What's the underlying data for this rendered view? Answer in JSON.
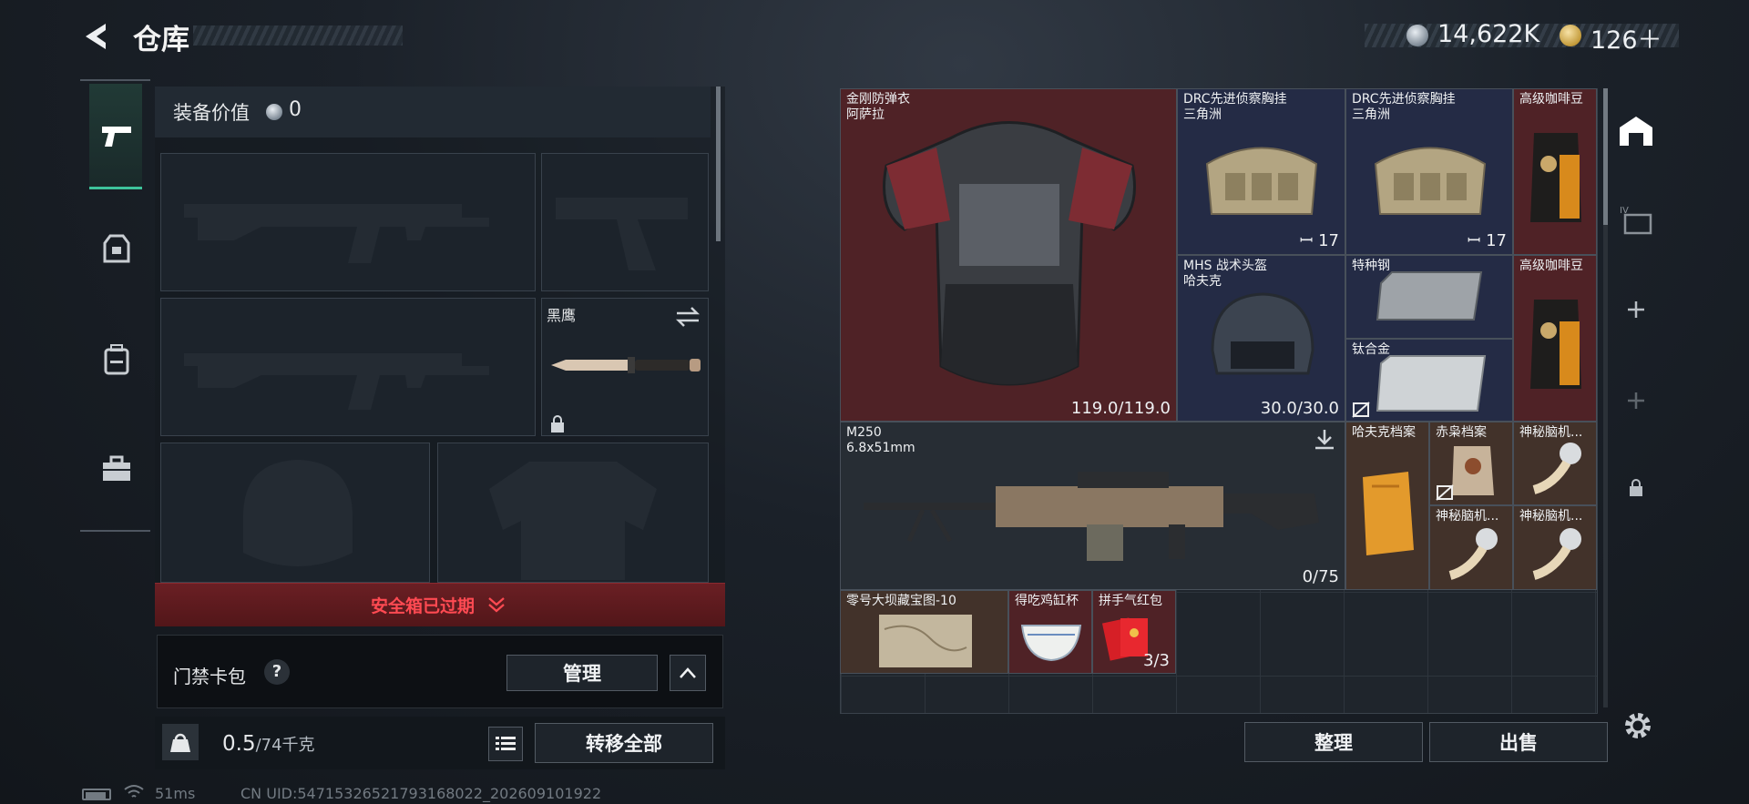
{
  "header": {
    "title": "仓库",
    "currency_silver": "14,622K",
    "currency_gold": "126＋"
  },
  "left_nav": [
    {
      "name": "weapon",
      "icon": "pistol-icon",
      "active": true
    },
    {
      "name": "armor",
      "icon": "vest-icon"
    },
    {
      "name": "backpack",
      "icon": "backpack-icon"
    },
    {
      "name": "kit",
      "icon": "toolbox-icon"
    }
  ],
  "loadout": {
    "value_label": "装备价值",
    "value": "0",
    "melee_name": "黑鹰",
    "safebox_status": "安全箱已过期",
    "card_pack_label": "门禁卡包",
    "card_help": "?",
    "manage_label": "管理",
    "weight_value": "0.5",
    "weight_capacity": "/74千克",
    "transfer_all_label": "转移全部"
  },
  "inventory": {
    "items": [
      {
        "id": "armor",
        "name": "金刚防弹衣\n阿萨拉",
        "count": "119.0/119.0",
        "rarity": "red"
      },
      {
        "id": "vest1",
        "name": "DRC先进侦察胸挂\n三角洲",
        "count": "17",
        "rarity": "blue"
      },
      {
        "id": "vest2",
        "name": "DRC先进侦察胸挂\n三角洲",
        "count": "17",
        "rarity": "blue"
      },
      {
        "id": "coffee1",
        "name": "高级咖啡豆",
        "count": "",
        "rarity": "red"
      },
      {
        "id": "helmet",
        "name": "MHS 战术头盔\n哈夫克",
        "count": "30.0/30.0",
        "rarity": "blue"
      },
      {
        "id": "steel",
        "name": "特种钢",
        "count": "",
        "rarity": "blue"
      },
      {
        "id": "alloy",
        "name": "钛合金",
        "count": "",
        "rarity": "blue"
      },
      {
        "id": "coffee2",
        "name": "高级咖啡豆",
        "count": "",
        "rarity": "red"
      },
      {
        "id": "mg",
        "name": "M250\n6.8x51mm",
        "count": "0/75",
        "rarity": "gray"
      },
      {
        "id": "file1",
        "name": "哈夫克档案",
        "count": "",
        "rarity": "brown"
      },
      {
        "id": "file2",
        "name": "赤枭档案",
        "count": "",
        "rarity": "brown"
      },
      {
        "id": "brain1",
        "name": "神秘脑机...",
        "count": "",
        "rarity": "brown"
      },
      {
        "id": "brain2",
        "name": "神秘脑机...",
        "count": "",
        "rarity": "brown"
      },
      {
        "id": "brain3",
        "name": "神秘脑机...",
        "count": "",
        "rarity": "brown"
      },
      {
        "id": "map",
        "name": "零号大坝藏宝图-10",
        "count": "",
        "rarity": "brown"
      },
      {
        "id": "cup",
        "name": "得吃鸡缸杯",
        "count": "",
        "rarity": "red"
      },
      {
        "id": "envelope",
        "name": "拼手气红包",
        "count": "3/3",
        "rarity": "red"
      }
    ],
    "sort_label": "整理",
    "sell_label": "出售"
  },
  "status_bar": {
    "ping": "51ms",
    "uid": "CN UID:5471532652179316802​2_202609101922"
  },
  "colors": {
    "accent_green": "#3ec49b",
    "danger_red": "#ff4a52",
    "rarity_red": "#4f2226",
    "rarity_blue": "#242b45"
  }
}
